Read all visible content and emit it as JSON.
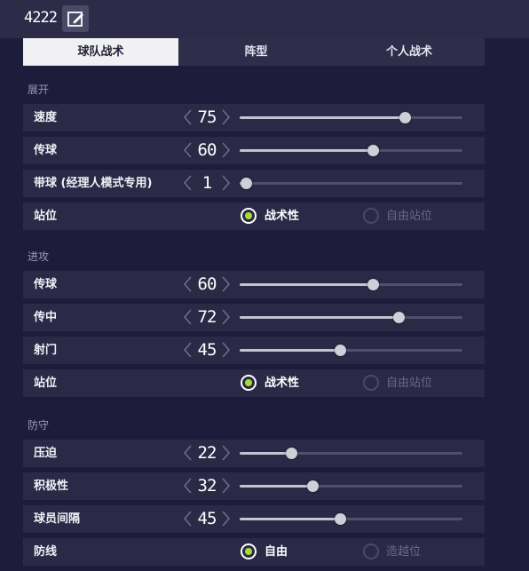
{
  "header": {
    "team_name": "4222"
  },
  "tabs": [
    "球队战术",
    "阵型",
    "个人战术"
  ],
  "active_tab": 0,
  "sections": {
    "unfold": {
      "title": "展开",
      "speed": {
        "label": "速度",
        "value": "75",
        "level": 75
      },
      "pass": {
        "label": "传球",
        "value": "60",
        "level": 60
      },
      "dribble": {
        "label": "带球 (经理人模式专用)",
        "value": "1",
        "level": 1
      },
      "position": {
        "label": "站位",
        "option_a": "战术性",
        "option_b": "自由站位",
        "selected": "option_a"
      }
    },
    "attack": {
      "title": "进攻",
      "pass": {
        "label": "传球",
        "value": "60",
        "level": 60
      },
      "cross": {
        "label": "传中",
        "value": "72",
        "level": 72
      },
      "shoot": {
        "label": "射门",
        "value": "45",
        "level": 45
      },
      "position": {
        "label": "站位",
        "option_a": "战术性",
        "option_b": "自由站位",
        "selected": "option_a"
      }
    },
    "defense": {
      "title": "防守",
      "pressure": {
        "label": "压迫",
        "value": "22",
        "level": 22
      },
      "aggression": {
        "label": "积极性",
        "value": "32",
        "level": 32
      },
      "spacing": {
        "label": "球员间隔",
        "value": "45",
        "level": 45
      },
      "line": {
        "label": "防线",
        "option_a": "自由",
        "option_b": "造越位",
        "selected": "option_a"
      }
    }
  },
  "slider_range": [
    0,
    100
  ],
  "colors": {
    "accent_green": "#a4e02b",
    "background": "#1d1c3a",
    "row_bg": "#2a2946"
  },
  "icons": {
    "edit": "edit-icon",
    "left": "chevron-left-icon",
    "right": "chevron-right-icon"
  }
}
